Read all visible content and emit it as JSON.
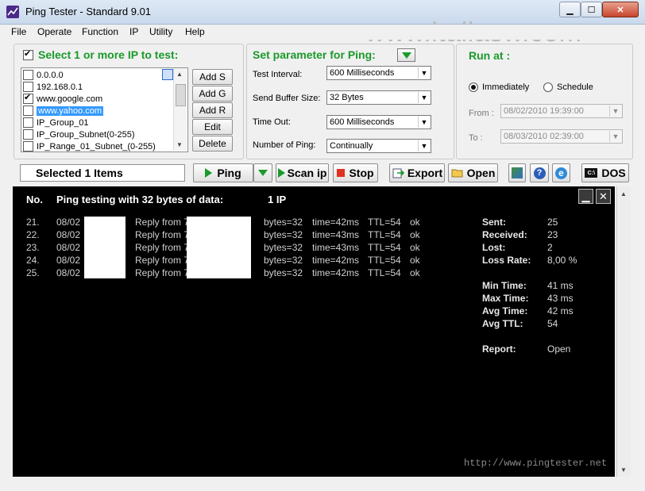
{
  "window": {
    "title": "Ping Tester - Standard  9.01"
  },
  "watermark": "www.italiasw.com",
  "menu": [
    "File",
    "Operate",
    "Function",
    "IP",
    "Utility",
    "Help"
  ],
  "ip_panel": {
    "title": "Select 1 or more IP to test:",
    "items": [
      {
        "label": "0.0.0.0",
        "checked": false,
        "selected": false
      },
      {
        "label": "192.168.0.1",
        "checked": false,
        "selected": false
      },
      {
        "label": "www.google.com",
        "checked": true,
        "selected": false
      },
      {
        "label": "www.yahoo.com",
        "checked": false,
        "selected": true
      },
      {
        "label": "IP_Group_01",
        "checked": false,
        "selected": false
      },
      {
        "label": "IP_Group_Subnet(0-255)",
        "checked": false,
        "selected": false
      },
      {
        "label": "IP_Range_01_Subnet_(0-255)",
        "checked": false,
        "selected": false
      }
    ],
    "buttons": [
      "Add S",
      "Add G",
      "Add R",
      "Edit",
      "Delete"
    ]
  },
  "param_panel": {
    "title": "Set parameter for Ping:",
    "fields": [
      {
        "label": "Test Interval:",
        "value": "600  Milliseconds"
      },
      {
        "label": "Send Buffer Size:",
        "value": "32  Bytes"
      },
      {
        "label": "Time Out:",
        "value": "600  Milliseconds"
      },
      {
        "label": "Number of Ping:",
        "value": "Continually"
      }
    ]
  },
  "run_panel": {
    "title": "Run at :",
    "immediately": "Immediately",
    "schedule": "Schedule",
    "from_label": "From :",
    "from_value": "08/02/2010 19:39:00",
    "to_label": "To :",
    "to_value": "08/03/2010 02:39:00"
  },
  "toolbar": {
    "status": "Selected 1 Items",
    "ping": "Ping",
    "scan": "Scan ip",
    "stop": "Stop",
    "export": "Export",
    "open": "Open",
    "dos": "DOS"
  },
  "console": {
    "col_no": "No.",
    "heading": "Ping testing with 32 bytes of data:",
    "count": "1  IP",
    "rows": [
      {
        "no": "21.",
        "date": "08/02",
        "reply": "Reply from 7",
        "bytes": "bytes=32",
        "time": "time=42ms",
        "ttl": "TTL=54",
        "status": "ok"
      },
      {
        "no": "22.",
        "date": "08/02",
        "reply": "Reply from 7",
        "bytes": "bytes=32",
        "time": "time=43ms",
        "ttl": "TTL=54",
        "status": "ok"
      },
      {
        "no": "23.",
        "date": "08/02",
        "reply": "Reply from 7",
        "bytes": "bytes=32",
        "time": "time=43ms",
        "ttl": "TTL=54",
        "status": "ok"
      },
      {
        "no": "24.",
        "date": "08/02",
        "reply": "Reply from 7",
        "bytes": "bytes=32",
        "time": "time=42ms",
        "ttl": "TTL=54",
        "status": "ok"
      },
      {
        "no": "25.",
        "date": "08/02",
        "reply": "Reply from 7",
        "bytes": "bytes=32",
        "time": "time=42ms",
        "ttl": "TTL=54",
        "status": "ok"
      }
    ],
    "stats": [
      {
        "label": "Sent:",
        "value": "25"
      },
      {
        "label": "Received:",
        "value": "23"
      },
      {
        "label": "Lost:",
        "value": "2"
      },
      {
        "label": "Loss Rate:",
        "value": "8,00 %"
      },
      {
        "label": "Min Time:",
        "value": "41 ms"
      },
      {
        "label": "Max Time:",
        "value": "43 ms"
      },
      {
        "label": "Avg Time:",
        "value": "42 ms"
      },
      {
        "label": "Avg TTL:",
        "value": "54"
      },
      {
        "label": "Report:",
        "value": "Open"
      }
    ],
    "url": "http://www.pingtester.net"
  },
  "colors": {
    "accent_green": "#1a9a2a",
    "selection": "#3399ff",
    "console_bg": "#000000"
  }
}
